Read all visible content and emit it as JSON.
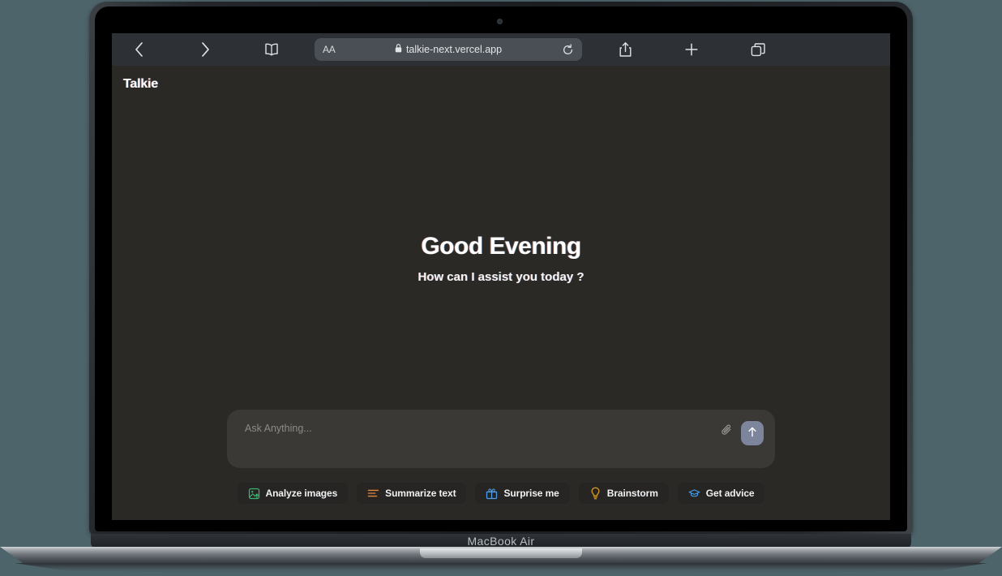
{
  "device": {
    "model_label": "MacBook Air"
  },
  "browser": {
    "back_icon": "chevron-left-icon",
    "forward_icon": "chevron-right-icon",
    "bookmarks_icon": "book-icon",
    "text_size_label": "AA",
    "lock_icon": "lock-icon",
    "url": "talkie-next.vercel.app",
    "reload_icon": "reload-icon",
    "share_icon": "share-icon",
    "new_tab_icon": "plus-icon",
    "tabs_icon": "tabs-icon"
  },
  "app": {
    "logo": "Talkie",
    "greeting": {
      "title": "Good Evening",
      "subtitle": "How can I assist you today ?"
    },
    "composer": {
      "placeholder": "Ask Anything...",
      "value": "",
      "attach_icon": "paperclip-icon",
      "send_icon": "arrow-up-icon",
      "send_button_color": "#7c859b"
    },
    "suggestions": [
      {
        "label": "Analyze images",
        "icon": "image-analyze-icon",
        "color": "#3cb371"
      },
      {
        "label": "Summarize text",
        "icon": "text-lines-icon",
        "color": "#e08840"
      },
      {
        "label": "Surprise me",
        "icon": "gift-icon",
        "color": "#4a9eea"
      },
      {
        "label": "Brainstorm",
        "icon": "lightbulb-icon",
        "color": "#e0a020"
      },
      {
        "label": "Get advice",
        "icon": "graduation-cap-icon",
        "color": "#4a9eea"
      }
    ]
  },
  "colors": {
    "page_background": "#4d646b",
    "app_background": "#2b2926",
    "toolbar_background": "#2d3136",
    "composer_background": "#3b3936",
    "chip_background": "#262524"
  }
}
